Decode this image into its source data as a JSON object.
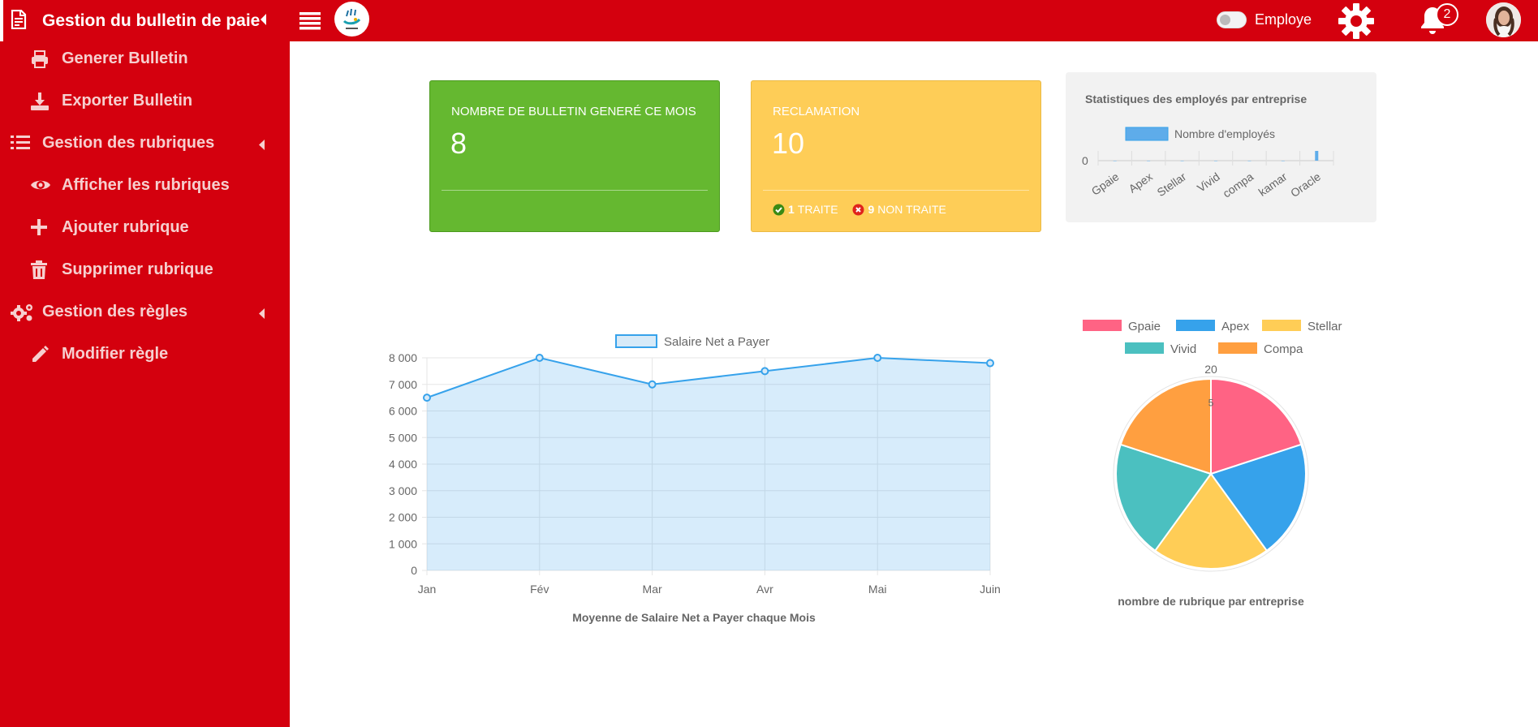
{
  "header": {
    "title": "Gestion du bulletin de paie",
    "toggle_label": "Employe",
    "notification_count": "2"
  },
  "sidebar": {
    "items": [
      {
        "label": "Generer Bulletin",
        "icon": "printer-icon"
      },
      {
        "label": "Exporter Bulletin",
        "icon": "download-icon"
      },
      {
        "label": "Gestion des rubriques",
        "icon": "list-icon"
      },
      {
        "label": "Afficher les rubriques",
        "icon": "eye-icon"
      },
      {
        "label": "Ajouter rubrique",
        "icon": "plus-icon"
      },
      {
        "label": "Supprimer rubrique",
        "icon": "trash-icon"
      },
      {
        "label": "Gestion des règles",
        "icon": "cogs-icon"
      },
      {
        "label": "Modifier règle",
        "icon": "pencil-icon"
      }
    ]
  },
  "cards": {
    "bulletins": {
      "title": "NOMBRE DE BULLETIN GENERÉ CE MOIS",
      "value": "8"
    },
    "reclamation": {
      "title": "RECLAMATION",
      "value": "10",
      "treated_count": "1",
      "treated_label": "TRAITE",
      "untreated_count": "9",
      "untreated_label": "NON TRAITE"
    }
  },
  "colors": {
    "primary_red": "#d4000e",
    "green_card": "#65b830",
    "yellow_card": "#fecd57",
    "line_series": "#36a2eb"
  },
  "chart_data": [
    {
      "type": "bar",
      "title": "Statistiques des employés par entreprise",
      "legend": "top",
      "categories": [
        "Gpaie",
        "Apex",
        "Stellar",
        "Vivid",
        "compa",
        "kamar",
        "Oracle"
      ],
      "series": [
        {
          "name": "Nombre d'employés",
          "values": [
            0,
            0,
            0,
            0,
            0,
            0,
            0.3
          ]
        }
      ],
      "yticks": [
        "0"
      ]
    },
    {
      "type": "area",
      "title": "Moyenne de Salaire Net a Payer chaque Mois",
      "legend": "top",
      "categories": [
        "Jan",
        "Fév",
        "Mar",
        "Avr",
        "Mai",
        "Juin"
      ],
      "series": [
        {
          "name": "Salaire Net a Payer",
          "values": [
            6500,
            8000,
            7000,
            7500,
            8000,
            7800
          ]
        }
      ],
      "ylim": [
        0,
        8000
      ],
      "yticks": [
        "0",
        "1 000",
        "2 000",
        "3 000",
        "4 000",
        "5 000",
        "6 000",
        "7 000",
        "8 000"
      ],
      "grid": true
    },
    {
      "type": "polarArea",
      "title": "nombre de rubrique par entreprise",
      "legend": "top",
      "categories": [
        "Gpaie",
        "Apex",
        "Stellar",
        "Vivid",
        "Compa"
      ],
      "values": [
        20,
        20,
        20,
        20,
        20
      ],
      "colors": [
        "#ff6384",
        "#36a2eb",
        "#ffcd56",
        "#4bc0c0",
        "#ff9f40"
      ],
      "rticks": [
        "20",
        "5"
      ]
    }
  ]
}
